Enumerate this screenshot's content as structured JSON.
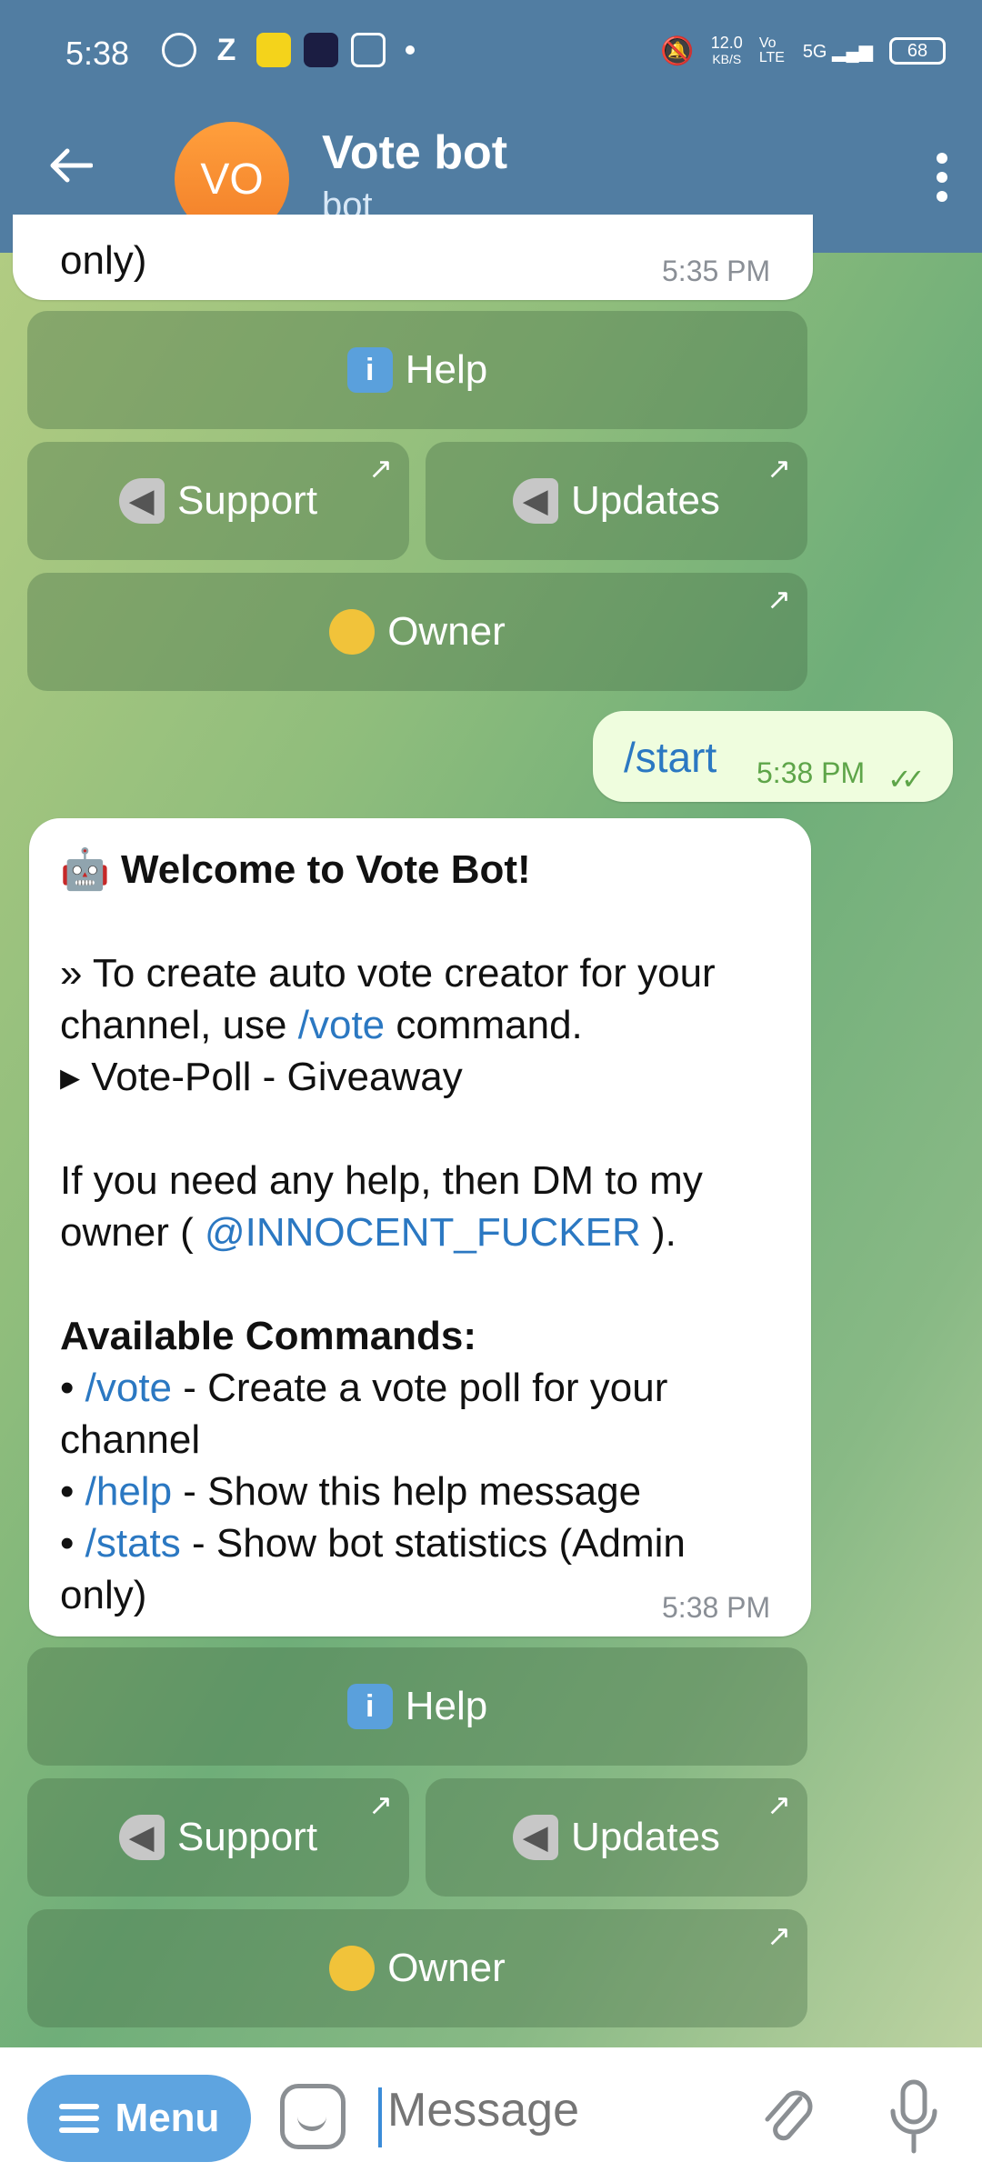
{
  "status_bar": {
    "time": "5:38",
    "net_speed_top": "12.0",
    "net_speed_bottom": "KB/S",
    "volte": "Vo LTE",
    "network": "5G",
    "battery": "68"
  },
  "header": {
    "avatar_initials": "VO",
    "title": "Vote bot",
    "subtitle": "bot"
  },
  "previous_message": {
    "text_tail": "only)",
    "time": "5:35 PM"
  },
  "keyboard_top": {
    "help": "Help",
    "support": "Support",
    "updates": "Updates",
    "owner": "Owner",
    "link_arrow": "↗",
    "info_glyph": "i"
  },
  "outgoing": {
    "text": "/start",
    "time": "5:38 PM",
    "ticks": "✓✓"
  },
  "welcome": {
    "emoji": "🤖",
    "title": "Welcome to Vote Bot!",
    "l1": "» To create auto vote creator for your",
    "l2a": "channel, use ",
    "l2cmd": "/vote",
    "l2b": " command.",
    "l3": "▸ Vote-Poll - Giveaway",
    "l4": "If you need any help, then DM to my",
    "l5a": "owner ( ",
    "l5user": "@INNOCENT_FUCKER",
    "l5b": " ).",
    "commands_header": "Available Commands:",
    "c1cmd": "/vote",
    "c1text": " - Create a vote poll for your",
    "c1cont": "channel",
    "c2cmd": "/help",
    "c2text": " - Show this help message",
    "c3cmd": "/stats",
    "c3text": " - Show bot statistics (Admin",
    "c3cont": "only)",
    "bullet": "• ",
    "time": "5:38 PM"
  },
  "keyboard_bottom": {
    "help": "Help",
    "support": "Support",
    "updates": "Updates",
    "owner": "Owner",
    "link_arrow": "↗",
    "info_glyph": "i"
  },
  "bottom_bar": {
    "menu_label": "Menu",
    "input_placeholder": "Message"
  }
}
